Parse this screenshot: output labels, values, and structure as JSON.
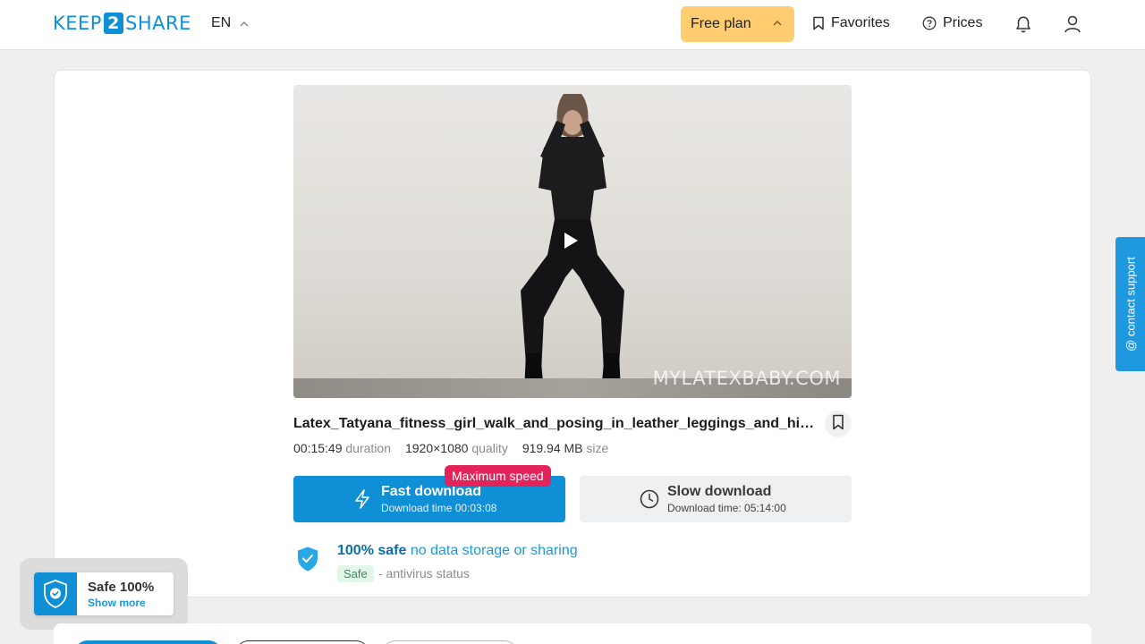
{
  "header": {
    "logo_left": "KEEP",
    "logo_mid": "2",
    "logo_right": "SHARE",
    "language": "EN",
    "plan_label": "Free plan",
    "favorites_label": "Favorites",
    "prices_label": "Prices"
  },
  "video": {
    "watermark": "MYLATEXBABY.COM"
  },
  "file": {
    "title": "Latex_Tatyana_fitness_girl_walk_and_posing_in_leather_leggings_and_high_h...",
    "duration": "00:15:49",
    "duration_label": "duration",
    "quality": "1920×1080",
    "quality_label": "quality",
    "size": "919.94 MB",
    "size_label": "size"
  },
  "downloads": {
    "badge": "Maximum speed",
    "fast_label": "Fast download",
    "fast_time": "Download time 00:03:08",
    "slow_label": "Slow download",
    "slow_time": "Download time: 05:14:00"
  },
  "safety": {
    "safe_strong": "100% safe",
    "safe_rest": "no data storage or sharing",
    "tag": "Safe",
    "antivirus": "- antivirus status"
  },
  "support": {
    "label": "@ contact support"
  },
  "safe_popup": {
    "title": "Safe 100%",
    "link": "Show more"
  },
  "colors": {
    "brand": "#0f8fd6",
    "plan": "#ffcc70",
    "badge": "#e4235b"
  }
}
